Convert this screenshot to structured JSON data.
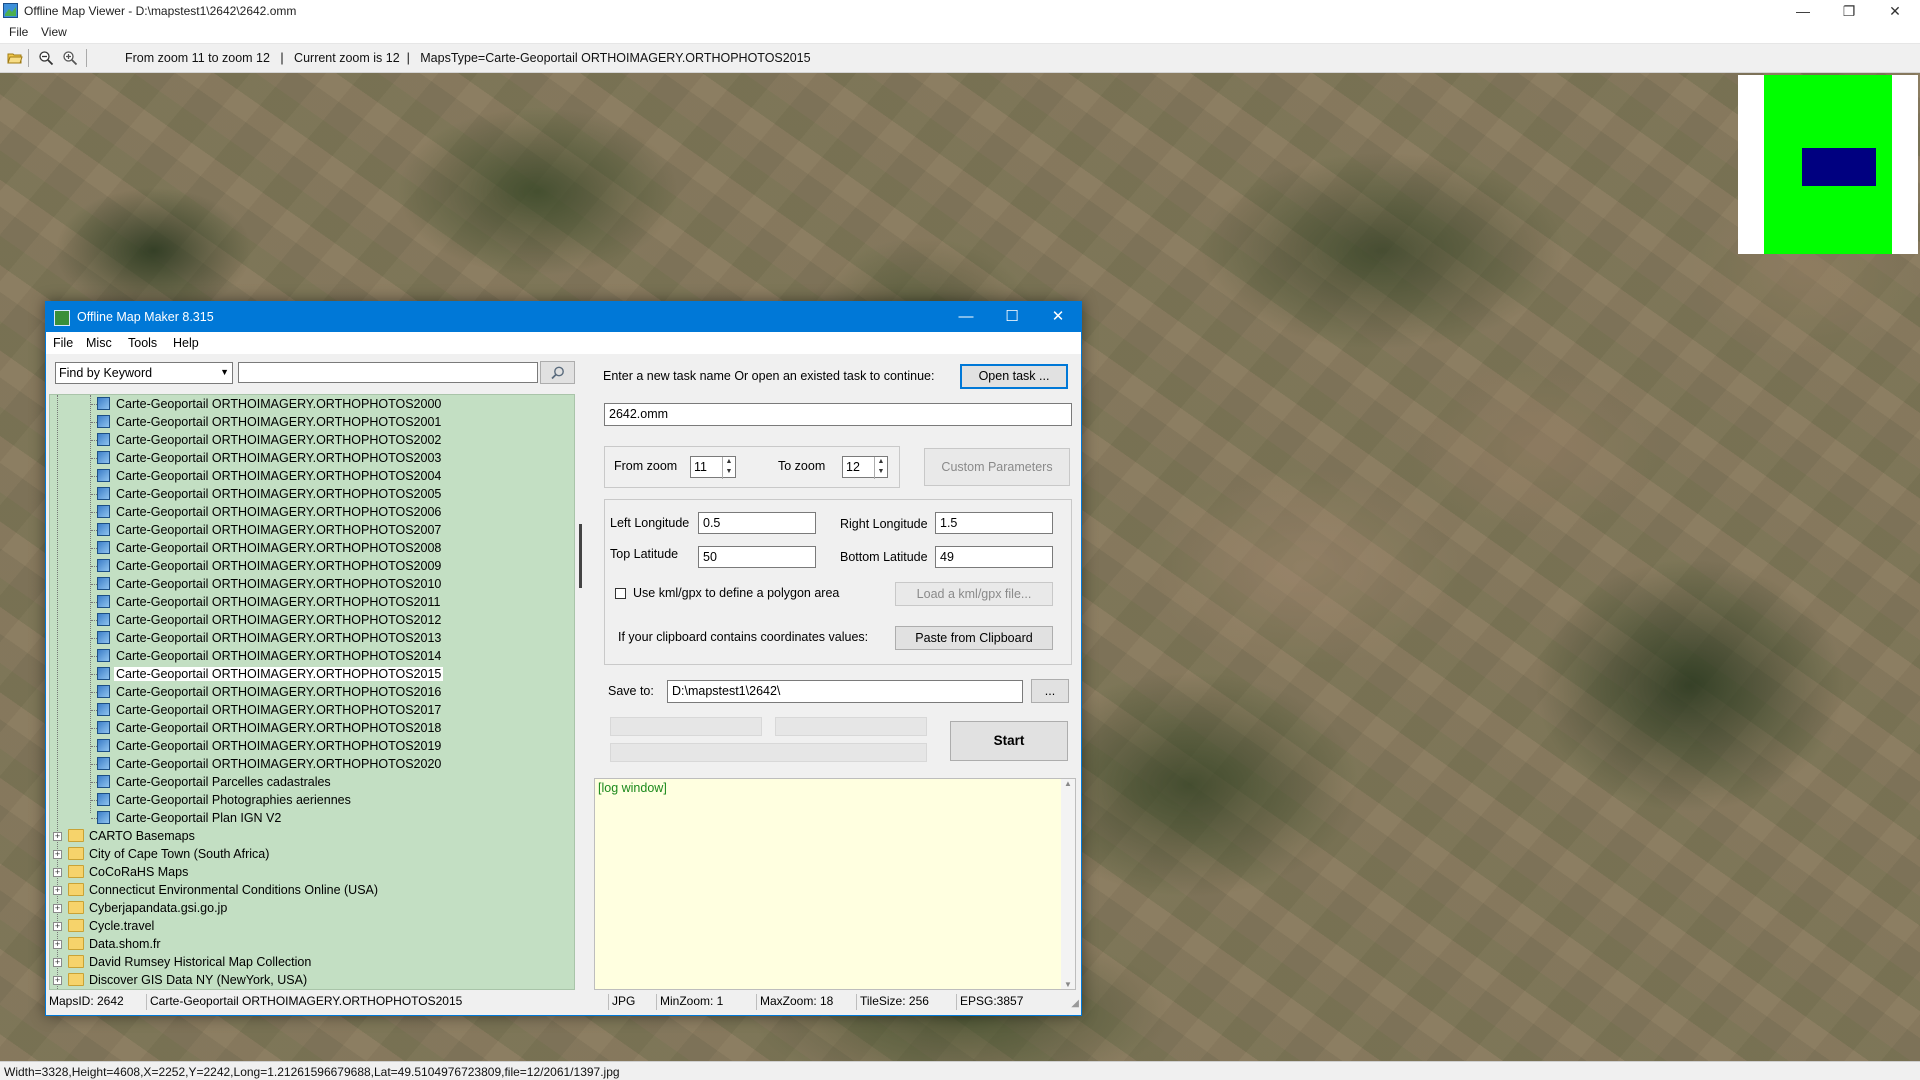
{
  "viewer": {
    "title": "Offline Map Viewer - D:\\mapstest1\\2642\\2642.omm",
    "menu": [
      "File",
      "View"
    ],
    "toolbar_info": "From zoom 11 to zoom 12   |   Current zoom is 12  |   MapsType=Carte-Geoportail ORTHOIMAGERY.ORTHOPHOTOS2015",
    "status": "Width=3328,Height=4608,X=2252,Y=2242,Long=1.21261596679688,Lat=49.5104976723809,file=12/2061/1397.jpg",
    "window_controls": {
      "minimize": "—",
      "maximize": "❐",
      "close": "✕"
    },
    "minimap_colors": {
      "extent": "#00ff00",
      "view": "#000080"
    }
  },
  "dialog": {
    "title": "Offline Map Maker 8.315",
    "menu": [
      "File",
      "Misc",
      "Tools",
      "Help"
    ],
    "window_controls": {
      "minimize": "—",
      "maximize": "☐",
      "close": "✕"
    },
    "search": {
      "mode": "Find by Keyword",
      "value": "",
      "search_icon": "magnifier-icon"
    },
    "tree": {
      "items": [
        {
          "label": "Carte-Geoportail ORTHOIMAGERY.ORTHOPHOTOS2000",
          "type": "map"
        },
        {
          "label": "Carte-Geoportail ORTHOIMAGERY.ORTHOPHOTOS2001",
          "type": "map"
        },
        {
          "label": "Carte-Geoportail ORTHOIMAGERY.ORTHOPHOTOS2002",
          "type": "map"
        },
        {
          "label": "Carte-Geoportail ORTHOIMAGERY.ORTHOPHOTOS2003",
          "type": "map"
        },
        {
          "label": "Carte-Geoportail ORTHOIMAGERY.ORTHOPHOTOS2004",
          "type": "map"
        },
        {
          "label": "Carte-Geoportail ORTHOIMAGERY.ORTHOPHOTOS2005",
          "type": "map"
        },
        {
          "label": "Carte-Geoportail ORTHOIMAGERY.ORTHOPHOTOS2006",
          "type": "map"
        },
        {
          "label": "Carte-Geoportail ORTHOIMAGERY.ORTHOPHOTOS2007",
          "type": "map"
        },
        {
          "label": "Carte-Geoportail ORTHOIMAGERY.ORTHOPHOTOS2008",
          "type": "map"
        },
        {
          "label": "Carte-Geoportail ORTHOIMAGERY.ORTHOPHOTOS2009",
          "type": "map"
        },
        {
          "label": "Carte-Geoportail ORTHOIMAGERY.ORTHOPHOTOS2010",
          "type": "map"
        },
        {
          "label": "Carte-Geoportail ORTHOIMAGERY.ORTHOPHOTOS2011",
          "type": "map"
        },
        {
          "label": "Carte-Geoportail ORTHOIMAGERY.ORTHOPHOTOS2012",
          "type": "map"
        },
        {
          "label": "Carte-Geoportail ORTHOIMAGERY.ORTHOPHOTOS2013",
          "type": "map"
        },
        {
          "label": "Carte-Geoportail ORTHOIMAGERY.ORTHOPHOTOS2014",
          "type": "map"
        },
        {
          "label": "Carte-Geoportail ORTHOIMAGERY.ORTHOPHOTOS2015",
          "type": "map",
          "selected": true
        },
        {
          "label": "Carte-Geoportail ORTHOIMAGERY.ORTHOPHOTOS2016",
          "type": "map"
        },
        {
          "label": "Carte-Geoportail ORTHOIMAGERY.ORTHOPHOTOS2017",
          "type": "map"
        },
        {
          "label": "Carte-Geoportail ORTHOIMAGERY.ORTHOPHOTOS2018",
          "type": "map"
        },
        {
          "label": "Carte-Geoportail ORTHOIMAGERY.ORTHOPHOTOS2019",
          "type": "map"
        },
        {
          "label": "Carte-Geoportail ORTHOIMAGERY.ORTHOPHOTOS2020",
          "type": "map"
        },
        {
          "label": "Carte-Geoportail Parcelles cadastrales",
          "type": "map"
        },
        {
          "label": "Carte-Geoportail Photographies aeriennes",
          "type": "map"
        },
        {
          "label": "Carte-Geoportail Plan IGN V2",
          "type": "map"
        },
        {
          "label": "CARTO Basemaps",
          "type": "folder"
        },
        {
          "label": "City of Cape Town (South Africa)",
          "type": "folder"
        },
        {
          "label": "CoCoRaHS Maps",
          "type": "folder"
        },
        {
          "label": "Connecticut Environmental Conditions Online (USA)",
          "type": "folder"
        },
        {
          "label": "Cyberjapandata.gsi.go.jp",
          "type": "folder"
        },
        {
          "label": "Cycle.travel",
          "type": "folder"
        },
        {
          "label": "Data.shom.fr",
          "type": "folder"
        },
        {
          "label": "David Rumsey Historical Map Collection",
          "type": "folder"
        },
        {
          "label": "Discover GIS Data NY (NewYork, USA)",
          "type": "folder"
        }
      ]
    },
    "task": {
      "prompt": "Enter a new task name Or open an existed task to continue:",
      "open_label": "Open task ...",
      "name_value": "2642.omm"
    },
    "zoom": {
      "from_label": "From zoom",
      "from_value": "11",
      "to_label": "To zoom",
      "to_value": "12",
      "custom_label": "Custom Parameters"
    },
    "area": {
      "left_lon_label": "Left Longitude",
      "left_lon": "0.5",
      "right_lon_label": "Right Longitude",
      "right_lon": "1.5",
      "top_lat_label": "Top Latitude",
      "top_lat": "50",
      "bottom_lat_label": "Bottom Latitude",
      "bottom_lat": "49",
      "kml_label": "Use kml/gpx to define a polygon area",
      "kml_checked": false,
      "load_kml_label": "Load a kml/gpx file...",
      "clipboard_label": "If your clipboard contains coordinates values:",
      "paste_label": "Paste from Clipboard"
    },
    "save": {
      "label": "Save to:",
      "value": "D:\\mapstest1\\2642\\",
      "browse_label": "..."
    },
    "start_label": "Start",
    "log_text": "[log window]",
    "status": {
      "maps_id": "MapsID: 2642",
      "map_name": "Carte-Geoportail ORTHOIMAGERY.ORTHOPHOTOS2015",
      "format": "JPG",
      "min_zoom": "MinZoom: 1",
      "max_zoom": "MaxZoom: 18",
      "tile_size": "TileSize: 256",
      "epsg": "EPSG:3857"
    }
  }
}
